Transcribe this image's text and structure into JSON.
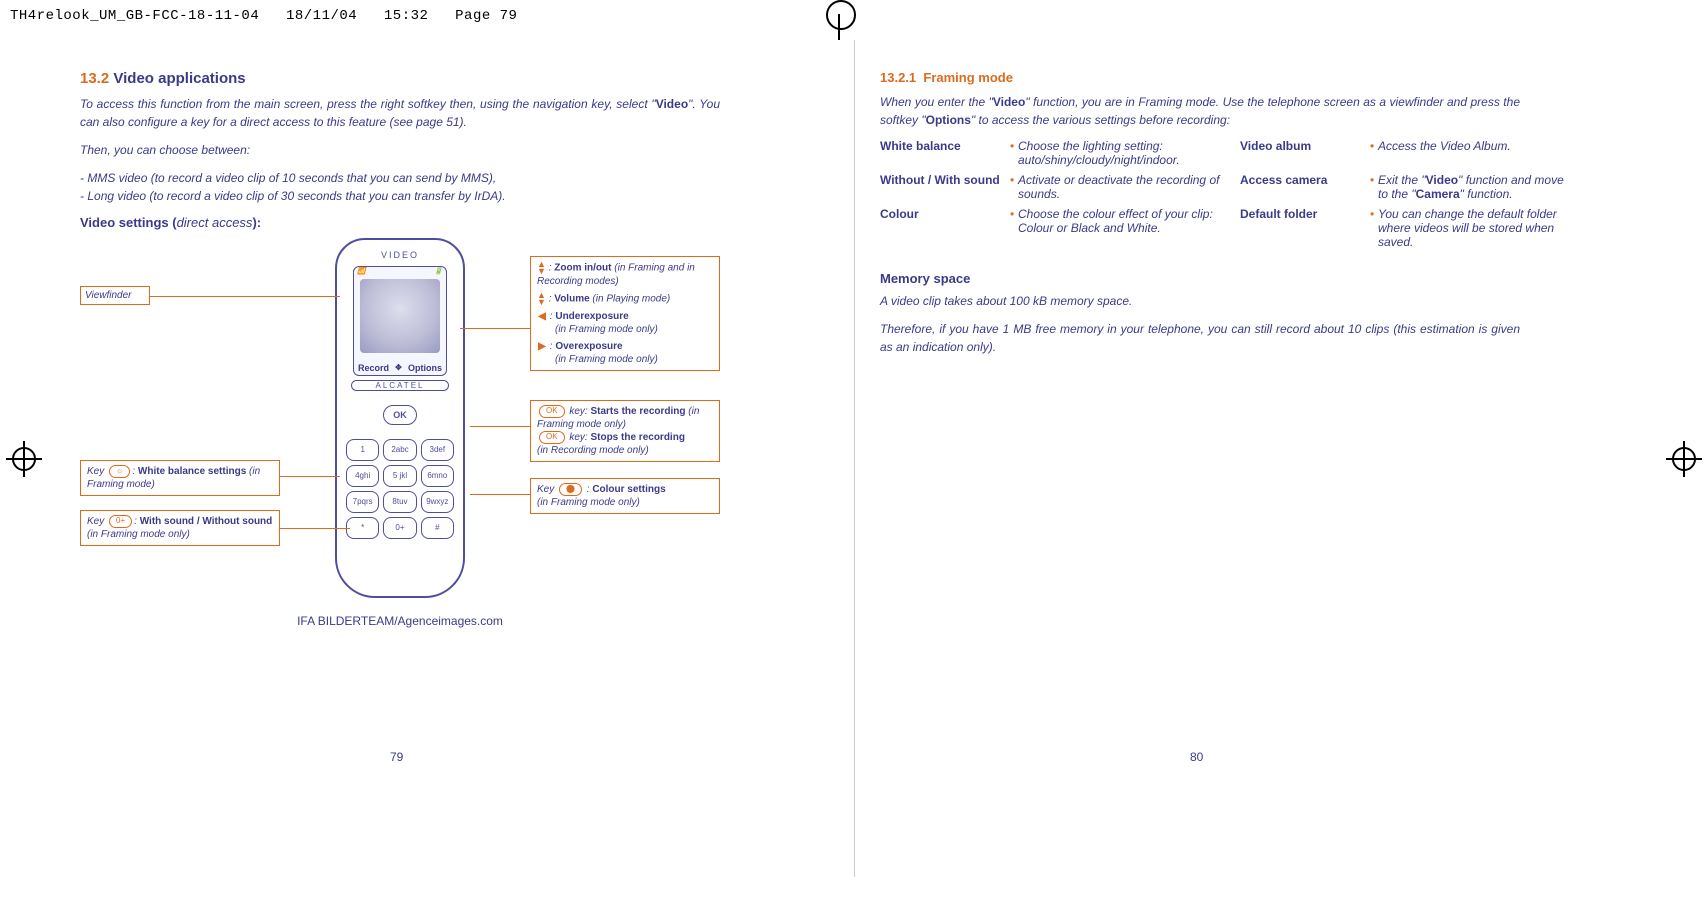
{
  "header": {
    "filename": "TH4relook_UM_GB-FCC-18-11-04",
    "date": "18/11/04",
    "time": "15:32",
    "page_label": "Page 79"
  },
  "left": {
    "section_num": "13.2",
    "section_title": "Video applications",
    "intro_1a": "To access this function from the main screen, press the right softkey then, using the navigation key, select \"",
    "intro_1_bold": "Video",
    "intro_1b": "\". You can also configure a key for a direct access to this feature (see page 51).",
    "choose_intro": "Then, you can choose between:",
    "choices": [
      "MMS video (to record a video clip of 10 seconds that you can send by MMS),",
      "Long video (to record a video clip of 30 seconds that you can transfer by IrDA)."
    ],
    "video_settings_label": "Video settings (",
    "video_settings_paren": "direct access",
    "video_settings_close": "):",
    "phone": {
      "top_brand": "VIDEO",
      "brand": "ALCATEL",
      "soft_left": "Record",
      "soft_right": "Options",
      "ok": "OK",
      "keys": [
        "1",
        "2abc",
        "3def",
        "4ghi",
        "5 jkl",
        "6mno",
        "7pqrs",
        "8tuv",
        "9wxyz",
        "*",
        "0+",
        "#"
      ]
    },
    "callouts": {
      "viewfinder": "Viewfinder",
      "wb_pre": "Key ",
      "wb_key": "",
      "wb_label_a": ": ",
      "wb_label_b": "White balance settings",
      "wb_label_c": " (in Framing mode)",
      "snd_pre": "Key ",
      "snd_label_b": "With sound / Without sound",
      "snd_label_c": " (in Framing mode only)",
      "zoom_b": "Zoom in/out",
      "zoom_c": " (in Framing and in Recording modes)",
      "vol_b": "Volume",
      "vol_c": " (in Playing mode)",
      "under_b": "Underexposure",
      "under_c": "(in Framing mode only)",
      "over_b": "Overexposure",
      "over_c": "(in Framing mode only)",
      "rec_a": " key: ",
      "rec_start_b": "Starts the recording",
      "rec_start_c": " (in Framing mode only)",
      "rec_stop_b": "Stops the recording",
      "rec_stop_c": "(in Recording mode only)",
      "colour_pre": "Key ",
      "colour_b": "Colour settings",
      "colour_c": "(in Framing mode only)"
    },
    "ifa": "IFA BILDERTEAM/Agenceimages.com",
    "page_num": "79"
  },
  "right": {
    "sub_num": "13.2.1",
    "sub_title": "Framing mode",
    "intro_a": "When you enter the \"",
    "intro_bold1": "Video",
    "intro_b": "\" function, you are in Framing mode. Use the telephone screen as a viewfinder and press the softkey \"",
    "intro_bold2": "Options",
    "intro_c": "\" to access the various settings before recording:",
    "options": [
      {
        "label": "White balance",
        "desc": "Choose the lighting setting: auto/shiny/cloudy/night/indoor."
      },
      {
        "label": "Without / With sound",
        "desc": "Activate or deactivate the recording of sounds."
      },
      {
        "label": "Colour",
        "desc": "Choose the colour effect of your clip: Colour or Black and White."
      },
      {
        "label": "Video album",
        "desc": "Access the Video Album."
      },
      {
        "label": "Access camera",
        "desc_a": "Exit the \"",
        "desc_bold1": "Video",
        "desc_b": "\" function and move to the \"",
        "desc_bold2": "Camera",
        "desc_c": "\" function."
      },
      {
        "label": "Default folder",
        "desc": "You can change the default folder where videos will be stored when saved."
      }
    ],
    "mem_h": "Memory space",
    "mem_p1": "A video clip takes about 100 kB memory space.",
    "mem_p2": "Therefore, if you have 1 MB free memory in your telephone, you can still record about 10 clips (this estimation is given as an indication only).",
    "page_num": "80"
  }
}
